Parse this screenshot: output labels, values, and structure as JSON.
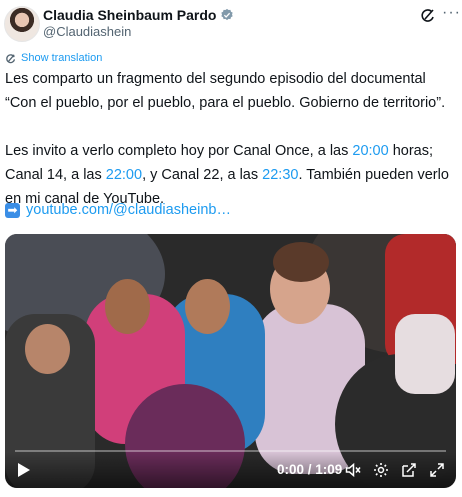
{
  "author": {
    "name": "Claudia Sheinbaum Pardo",
    "handle": "@Claudiashein"
  },
  "header": {
    "more": "···"
  },
  "translate": {
    "label": "Show translation"
  },
  "tweet": {
    "line1": "Les comparto un fragmento del segundo episodio del documental “Con el pueblo, por el pueblo, para el pueblo. Gobierno de territorio”.",
    "p2_a": "Les invito a verlo completo hoy por Canal Once, a las ",
    "t1": "20:00",
    "p2_b": " horas; Canal 14, a las ",
    "t2": "22:00",
    "p2_c": ", y Canal 22, a las ",
    "t3": "22:30",
    "p2_d": ". También pueden verlo en mi canal de YouTube.",
    "link_arrow": "➡",
    "link": "youtube.com/@claudiasheinb…"
  },
  "video": {
    "time": "0:00 / 1:09",
    "progress": 0.0
  },
  "colors": {
    "accent": "#1d9bf0",
    "text": "#0f1419",
    "muted": "#536471",
    "verified": "#829aab"
  }
}
